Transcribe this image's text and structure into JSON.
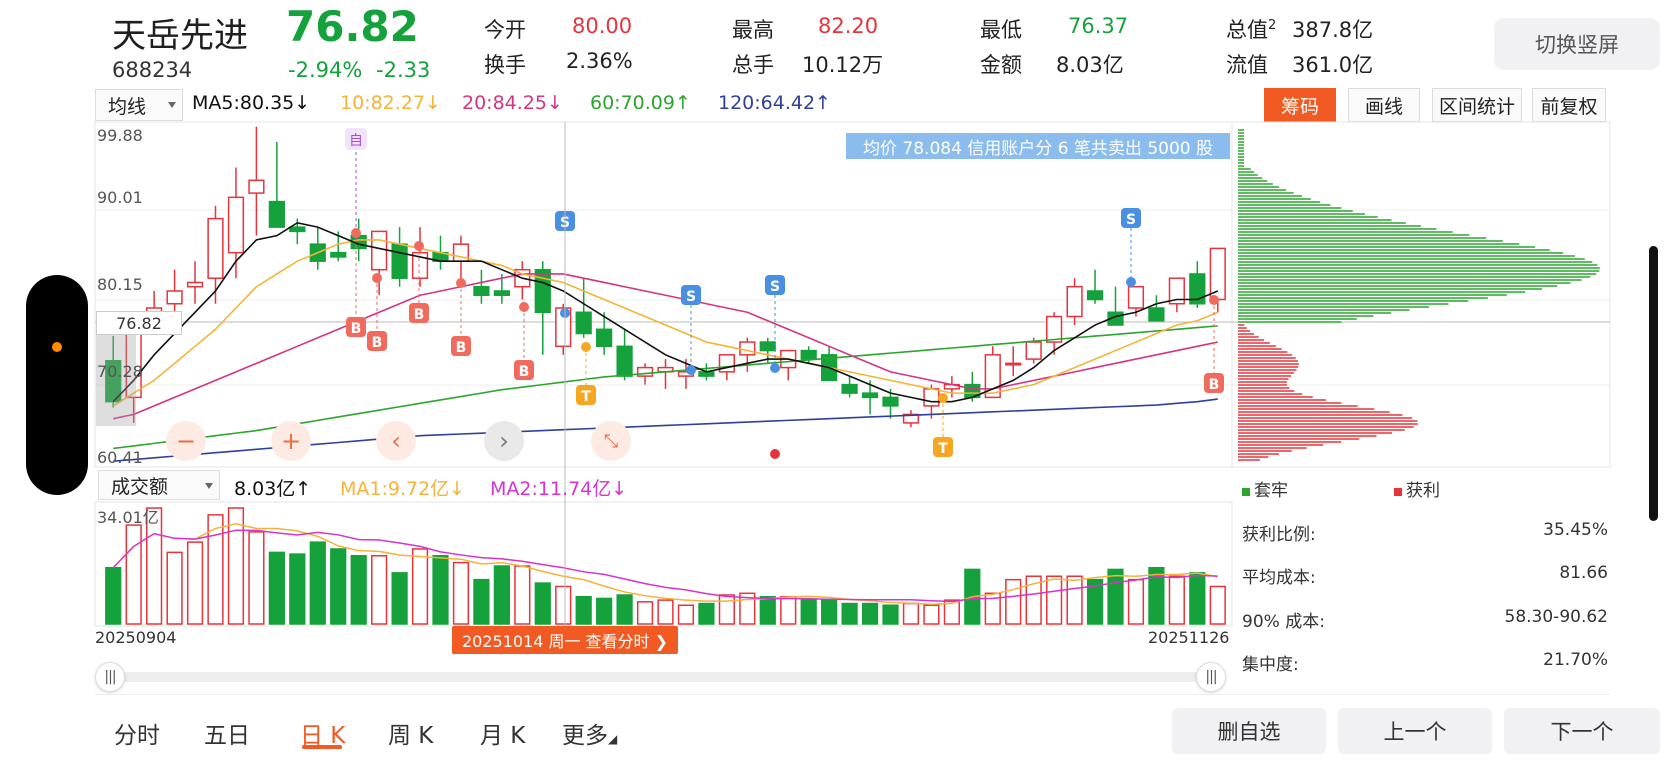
{
  "header": {
    "name": "天岳先进",
    "price": "76.82",
    "code": "688234",
    "change_pct": "-2.94%",
    "change_amt": "-2.33",
    "quotes": [
      {
        "label": "今开",
        "value": "80.00",
        "color": "red"
      },
      {
        "label": "最高",
        "value": "82.20",
        "color": "red"
      },
      {
        "label": "最低",
        "value": "76.37",
        "color": "green"
      },
      {
        "label": "换手",
        "value": "2.36%",
        "color": "dark"
      },
      {
        "label": "总手",
        "value": "10.12万",
        "color": "dark"
      },
      {
        "label": "金额",
        "value": "8.03亿",
        "color": "dark"
      }
    ],
    "total_value_label": "总值",
    "total_value_sup": "2",
    "total_value": "387.8亿",
    "float_value_label": "流值",
    "float_value": "361.0亿",
    "rotate_button": "切换竖屏"
  },
  "ma_bar": {
    "selector": "均线",
    "ma5": "MA5:80.35↓",
    "ma10": "10:82.27↓",
    "ma20": "20:84.25↓",
    "ma60": "60:70.09↑",
    "ma120": "120:64.42↑"
  },
  "tools": [
    "筹码",
    "画线",
    "区间统计",
    "前复权"
  ],
  "price_axis": [
    "99.88",
    "90.01",
    "80.15",
    "70.28",
    "60.41"
  ],
  "current_price_tag": "76.82",
  "announcement": "均价 78.084 信用账户分 6 笔共卖出 5000 股",
  "markers": {
    "self": "自",
    "buy": "B",
    "sell": "S",
    "t": "T"
  },
  "volume_bar": {
    "selector": "成交额",
    "value": "8.03亿↑",
    "ma1": "MA1:9.72亿↓",
    "ma2": "MA2:11.74亿↓",
    "max_label": "34.01亿"
  },
  "dates": {
    "start": "20250904",
    "end": "20251126",
    "tooltip": "20251014 周一 查看分时 ❯"
  },
  "chip": {
    "legend_trapped": "套牢",
    "legend_profit": "获利",
    "stats": [
      {
        "label": "获利比例:",
        "value": "35.45%"
      },
      {
        "label": "平均成本:",
        "value": "81.66"
      },
      {
        "label": "90% 成本:",
        "value": "58.30-90.62"
      },
      {
        "label": "集中度:",
        "value": "21.70%"
      }
    ]
  },
  "tabs": [
    "分时",
    "五日",
    "日 K",
    "周 K",
    "月 K",
    "更多"
  ],
  "active_tab": "日 K",
  "bottom_buttons": [
    "删自选",
    "上一个",
    "下一个"
  ],
  "colors": {
    "up": "#e5343c",
    "down": "#15a13b",
    "ma5": "#111111",
    "ma10": "#f5b338",
    "ma20": "#d63384",
    "ma60": "#2ba52e",
    "ma120": "#2f3f9e",
    "accent": "#f15a22",
    "sell_marker": "#4a90e2",
    "buy_marker": "#f06b5d",
    "t_marker": "#f5a623"
  },
  "chart_data": {
    "type": "candlestick",
    "ylim": [
      60.41,
      99.88
    ],
    "candles": [
      [
        72.3,
        75.2,
        66.8,
        67.5
      ],
      [
        68.0,
        76.5,
        65.0,
        76.0
      ],
      [
        78.0,
        80.5,
        77.0,
        78.5
      ],
      [
        79.0,
        83.0,
        77.0,
        80.5
      ],
      [
        81.0,
        84.0,
        79.0,
        81.5
      ],
      [
        82.0,
        90.5,
        79.0,
        89.0
      ],
      [
        85.0,
        95.0,
        82.0,
        91.5
      ],
      [
        92.0,
        99.8,
        87.0,
        93.5
      ],
      [
        91.0,
        98.0,
        88.0,
        88.0
      ],
      [
        88.0,
        89.0,
        86.0,
        87.5
      ],
      [
        86.0,
        88.0,
        83.0,
        84.0
      ],
      [
        85.0,
        87.5,
        84.0,
        84.5
      ],
      [
        87.0,
        89.0,
        84.0,
        85.5
      ],
      [
        83.0,
        87.0,
        80.0,
        87.5
      ],
      [
        86.0,
        88.0,
        81.0,
        82.0
      ],
      [
        82.0,
        88.0,
        81.0,
        85.0
      ],
      [
        85.0,
        87.0,
        83.0,
        84.0
      ],
      [
        84.0,
        87.0,
        82.0,
        86.0
      ],
      [
        81.0,
        83.0,
        79.0,
        80.0
      ],
      [
        80.5,
        82.5,
        79.0,
        80.0
      ],
      [
        81.0,
        84.0,
        79.5,
        83.0
      ],
      [
        83.0,
        84.0,
        73.0,
        78.0
      ],
      [
        74.0,
        79.0,
        73.0,
        78.5
      ],
      [
        78.0,
        82.0,
        75.0,
        75.5
      ],
      [
        76.0,
        78.0,
        73.0,
        74.0
      ],
      [
        74.0,
        76.0,
        70.0,
        70.5
      ],
      [
        70.5,
        72.0,
        69.5,
        71.5
      ],
      [
        71.0,
        72.5,
        69.0,
        71.5
      ],
      [
        70.5,
        72.5,
        69.0,
        71.0
      ],
      [
        71.0,
        72.0,
        70.0,
        70.5
      ],
      [
        71.0,
        73.0,
        70.0,
        73.0
      ],
      [
        73.0,
        75.0,
        71.0,
        74.5
      ],
      [
        74.5,
        75.0,
        72.0,
        73.5
      ],
      [
        71.5,
        73.5,
        70.0,
        73.5
      ],
      [
        73.5,
        74.0,
        72.0,
        72.5
      ],
      [
        73.0,
        74.0,
        70.0,
        70.0
      ],
      [
        69.5,
        70.5,
        68.0,
        68.5
      ],
      [
        68.5,
        70.0,
        66.0,
        68.0
      ],
      [
        68.0,
        69.0,
        65.5,
        67.0
      ],
      [
        65.0,
        66.5,
        64.5,
        66.0
      ],
      [
        67.0,
        69.5,
        65.5,
        69.0
      ],
      [
        69.0,
        70.5,
        68.0,
        69.5
      ],
      [
        69.5,
        71.0,
        67.5,
        68.0
      ],
      [
        68.0,
        74.0,
        68.0,
        73.0
      ],
      [
        72.0,
        74.0,
        70.5,
        72.0
      ],
      [
        72.5,
        75.0,
        72.0,
        74.5
      ],
      [
        74.5,
        78.0,
        73.0,
        77.5
      ],
      [
        77.5,
        82.0,
        76.5,
        81.0
      ],
      [
        80.5,
        83.0,
        79.0,
        79.5
      ],
      [
        78.0,
        81.0,
        76.5,
        76.5
      ],
      [
        78.5,
        81.0,
        77.5,
        81.0
      ],
      [
        78.5,
        80.0,
        77.0,
        77.0
      ],
      [
        79.0,
        82.0,
        78.0,
        82.0
      ],
      [
        82.5,
        84.0,
        78.5,
        79.0
      ],
      [
        79.5,
        85.5,
        78.0,
        85.5
      ]
    ],
    "ma5": [
      67.5,
      70.0,
      73.0,
      75.5,
      78.0,
      80.5,
      84.0,
      86.5,
      87.0,
      88.5,
      88.0,
      87.0,
      86.0,
      85.5,
      85.0,
      84.5,
      84.0,
      84.0,
      84.0,
      83.0,
      82.0,
      81.5,
      80.5,
      79.0,
      77.5,
      76.0,
      74.5,
      73.0,
      72.0,
      71.0,
      71.5,
      72.0,
      72.5,
      72.5,
      72.0,
      71.5,
      70.5,
      69.5,
      68.5,
      68.0,
      67.5,
      67.5,
      68.0,
      69.0,
      70.0,
      71.5,
      73.5,
      75.0,
      76.5,
      77.5,
      78.0,
      79.0,
      79.5,
      79.5,
      80.5
    ],
    "ma10": [
      67.0,
      68.5,
      70.0,
      72.0,
      74.0,
      76.0,
      78.5,
      81.0,
      82.5,
      84.0,
      85.0,
      86.0,
      86.5,
      86.5,
      86.0,
      85.5,
      85.0,
      84.5,
      84.0,
      83.5,
      82.5,
      82.0,
      81.5,
      80.5,
      79.5,
      78.5,
      77.5,
      76.5,
      75.5,
      74.5,
      74.0,
      73.5,
      73.0,
      72.5,
      72.0,
      71.5,
      71.0,
      70.5,
      70.0,
      69.5,
      69.0,
      68.5,
      68.5,
      68.5,
      69.0,
      69.5,
      70.5,
      71.5,
      72.5,
      73.5,
      74.5,
      75.5,
      76.5,
      77.0,
      78.0
    ],
    "ma20": [
      65.5,
      66.0,
      67.0,
      68.0,
      69.0,
      70.0,
      71.0,
      72.0,
      73.0,
      74.0,
      75.0,
      76.0,
      77.0,
      78.0,
      79.0,
      80.0,
      80.5,
      81.0,
      81.5,
      82.0,
      82.5,
      82.5,
      82.5,
      82.0,
      81.5,
      81.0,
      80.5,
      80.0,
      79.5,
      79.0,
      78.5,
      78.0,
      77.0,
      76.0,
      75.0,
      74.0,
      73.0,
      72.0,
      71.0,
      70.5,
      70.0,
      69.5,
      69.0,
      69.0,
      69.5,
      70.0,
      70.5,
      71.0,
      71.5,
      72.0,
      72.5,
      73.0,
      73.5,
      74.0,
      74.5
    ],
    "ma60": [
      62.0,
      62.3,
      62.6,
      62.9,
      63.2,
      63.5,
      63.8,
      64.1,
      64.5,
      64.9,
      65.3,
      65.7,
      66.1,
      66.5,
      66.9,
      67.3,
      67.7,
      68.1,
      68.5,
      68.9,
      69.2,
      69.5,
      69.8,
      70.1,
      70.4,
      70.6,
      70.8,
      71.0,
      71.2,
      71.4,
      71.6,
      71.8,
      72.0,
      72.2,
      72.4,
      72.6,
      72.8,
      73.0,
      73.2,
      73.4,
      73.6,
      73.8,
      74.0,
      74.2,
      74.4,
      74.6,
      74.8,
      75.0,
      75.2,
      75.4,
      75.6,
      75.8,
      76.0,
      76.2,
      76.4
    ],
    "ma120": [
      60.5,
      60.7,
      60.9,
      61.1,
      61.3,
      61.5,
      61.7,
      61.9,
      62.1,
      62.3,
      62.5,
      62.7,
      62.9,
      63.1,
      63.3,
      63.5,
      63.6,
      63.7,
      63.8,
      63.9,
      64.0,
      64.1,
      64.2,
      64.3,
      64.4,
      64.5,
      64.6,
      64.7,
      64.8,
      64.9,
      65.0,
      65.1,
      65.2,
      65.3,
      65.4,
      65.5,
      65.6,
      65.7,
      65.8,
      65.9,
      66.0,
      66.1,
      66.2,
      66.3,
      66.4,
      66.5,
      66.6,
      66.7,
      66.8,
      66.9,
      67.0,
      67.1,
      67.3,
      67.5,
      67.8
    ],
    "volume_ylim": [
      0,
      34.01
    ],
    "volumes": [
      16.5,
      29.0,
      34.0,
      21.0,
      24.0,
      32.0,
      36.0,
      27.0,
      21.0,
      20.5,
      24.0,
      22.0,
      20.0,
      20.0,
      15.0,
      22.0,
      20.0,
      18.0,
      13.0,
      17.0,
      17.0,
      12.0,
      11.0,
      8.0,
      7.5,
      8.5,
      6.5,
      7.0,
      5.5,
      6.0,
      8.5,
      9.0,
      8.0,
      8.0,
      7.0,
      7.0,
      6.0,
      6.0,
      5.5,
      6.0,
      5.5,
      7.0,
      16.0,
      9.0,
      13.0,
      14.0,
      14.0,
      14.0,
      13.0,
      16.0,
      13.0,
      16.5,
      14.0,
      15.0,
      11.0
    ],
    "chip_distribution_note": "profile bars on price axis"
  }
}
